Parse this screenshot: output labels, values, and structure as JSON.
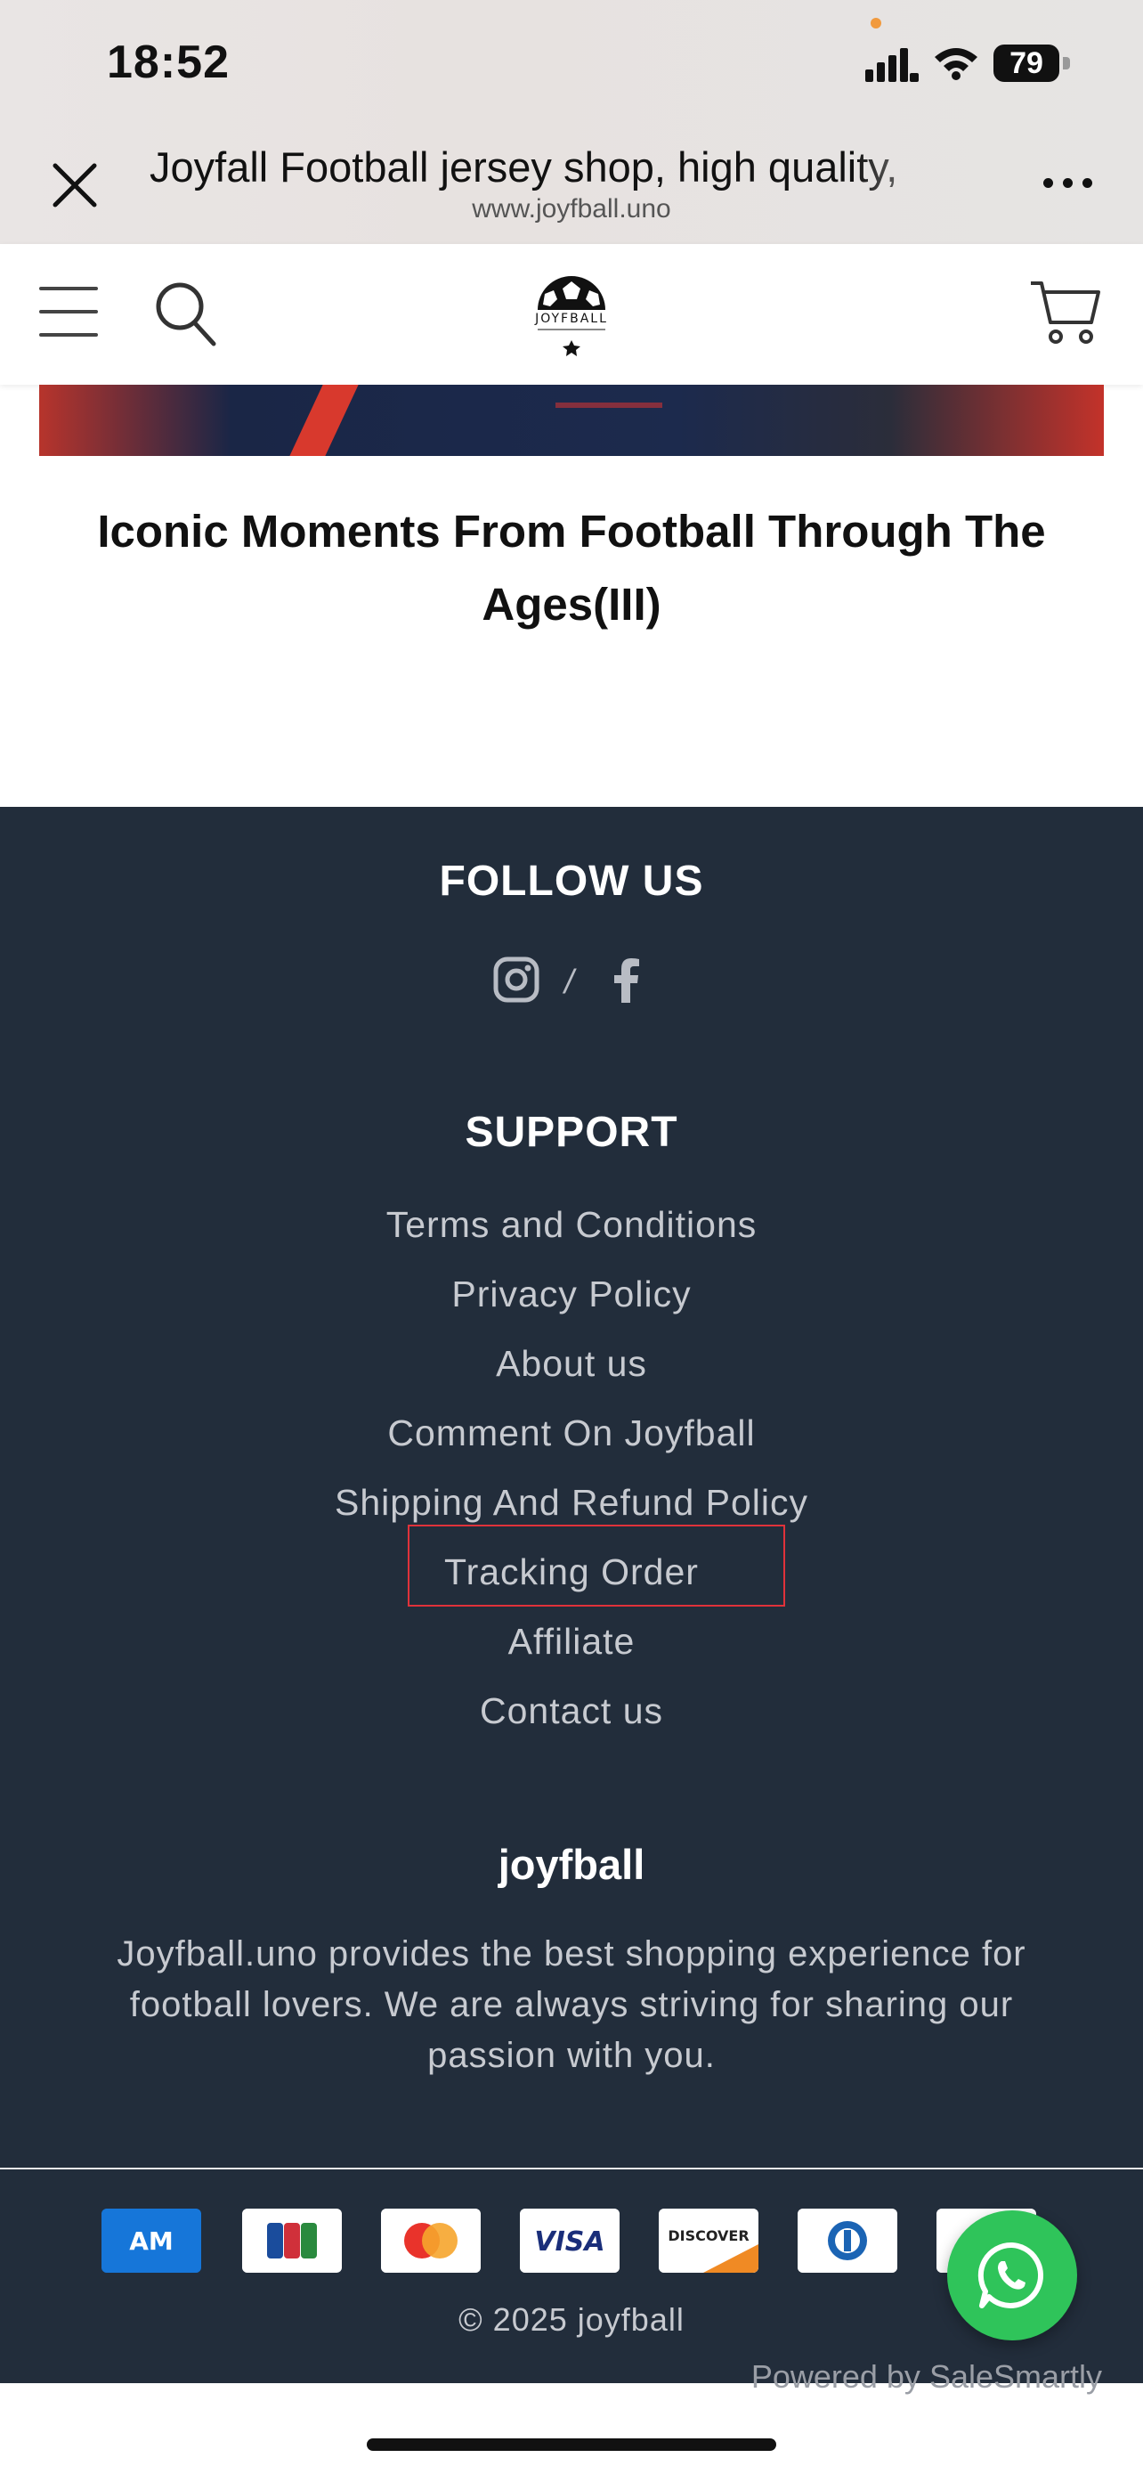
{
  "status_bar": {
    "time": "18:52",
    "battery": "79"
  },
  "browser": {
    "page_title": "Joyfall Football jersey shop, high quality,",
    "url": "www.joyfball.uno",
    "close_icon": "close-icon",
    "more_icon": "more-dots-icon"
  },
  "header": {
    "logo_text": "JOYFBALL",
    "icons": [
      "hamburger-menu-icon",
      "search-icon",
      "soccer-ball-logo",
      "cart-icon"
    ]
  },
  "article": {
    "title": "Iconic Moments From Football Through The Ages(III)"
  },
  "footer": {
    "follow_title": "FOLLOW US",
    "social": [
      "instagram-icon",
      "facebook-icon"
    ],
    "social_separator": "/",
    "support_title": "SUPPORT",
    "support_links": [
      "Terms and Conditions",
      "Privacy Policy",
      "About us",
      "Comment On Joyfball",
      "Shipping And Refund Policy",
      "Tracking Order",
      "Affiliate",
      "Contact us"
    ],
    "highlighted_link": "Tracking Order",
    "brand_name": "joyfball",
    "brand_description": "Joyfball.uno provides the best shopping experience for football lovers. We are always striving for sharing our passion with you.",
    "payment_methods": [
      "AMEX",
      "JCB",
      "Mastercard",
      "VISA",
      "DISCOVER",
      "Diners Club",
      "PayPal"
    ],
    "copyright": "© 2025 joyfball"
  },
  "chat_widget": {
    "icon": "whatsapp-icon",
    "powered_by": "Powered by SaleSmartly"
  },
  "colors": {
    "footer_bg": "#222d3b",
    "highlight": "#e0323a",
    "whatsapp": "#2fc45a"
  }
}
